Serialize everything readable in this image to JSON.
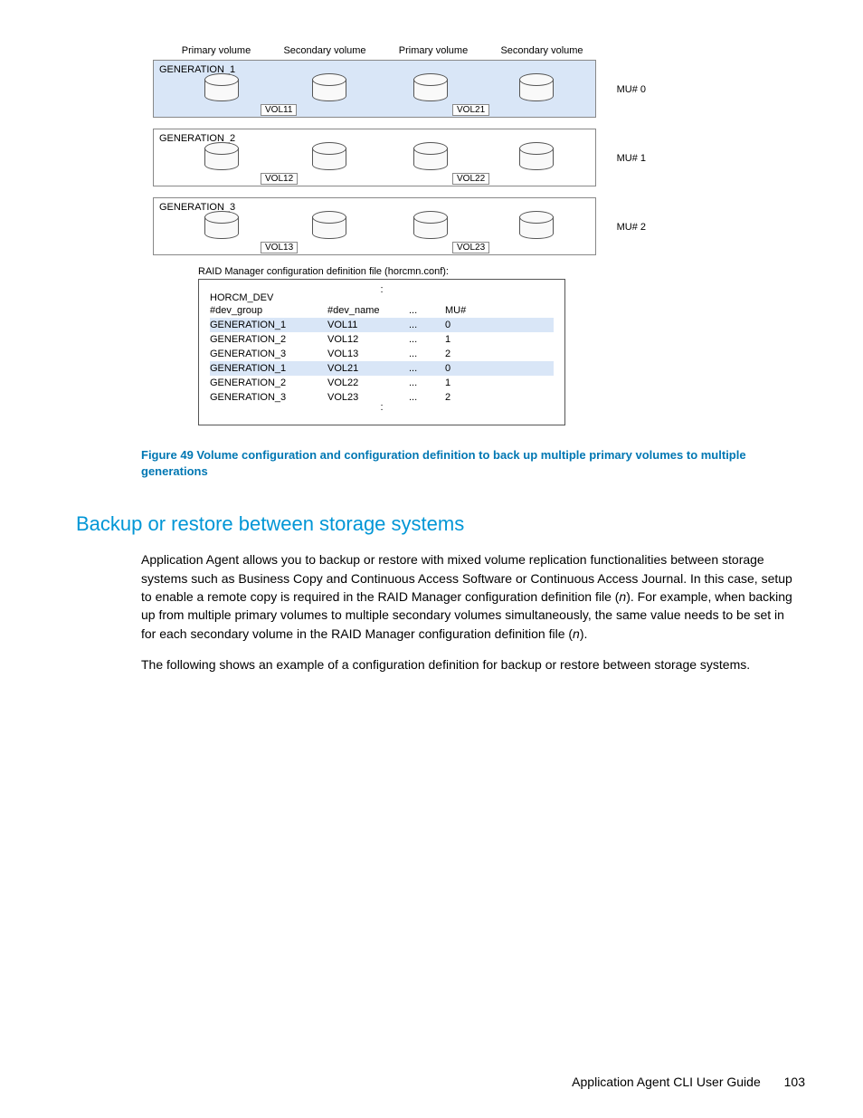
{
  "chart_data": {
    "type": "table",
    "diagram": {
      "column_headers": [
        "Primary volume",
        "Secondary volume",
        "Primary volume",
        "Secondary volume"
      ],
      "generations": [
        {
          "label": "GENERATION_1",
          "highlight": true,
          "vol_a": "VOL11",
          "vol_b": "VOL21",
          "mu": "MU# 0"
        },
        {
          "label": "GENERATION_2",
          "highlight": false,
          "vol_a": "VOL12",
          "vol_b": "VOL22",
          "mu": "MU# 1"
        },
        {
          "label": "GENERATION_3",
          "highlight": false,
          "vol_a": "VOL13",
          "vol_b": "VOL23",
          "mu": "MU# 2"
        }
      ]
    },
    "config_caption": "RAID Manager configuration definition file (horcmn.conf):",
    "config_header_title": "HORCM_DEV",
    "config_columns": {
      "c1": "#dev_group",
      "c2": "#dev_name",
      "c3": "...",
      "c4": "MU#"
    },
    "config_rows": [
      {
        "g": "GENERATION_1",
        "v": "VOL11",
        "d": "...",
        "m": "0",
        "hl": true
      },
      {
        "g": "GENERATION_2",
        "v": "VOL12",
        "d": "...",
        "m": "1",
        "hl": false
      },
      {
        "g": "GENERATION_3",
        "v": "VOL13",
        "d": "...",
        "m": "2",
        "hl": false
      },
      {
        "g": "GENERATION_1",
        "v": "VOL21",
        "d": "...",
        "m": "0",
        "hl": true
      },
      {
        "g": "GENERATION_2",
        "v": "VOL22",
        "d": "...",
        "m": "1",
        "hl": false
      },
      {
        "g": "GENERATION_3",
        "v": "VOL23",
        "d": "...",
        "m": "2",
        "hl": false
      }
    ]
  },
  "figure_caption": "Figure 49 Volume configuration and configuration definition to back up multiple primary volumes to multiple generations",
  "section_heading": "Backup or restore between storage systems",
  "para1_a": "Application Agent allows you to backup or restore with mixed volume replication functionalities between storage systems such as Business Copy and Continuous Access Software or Continuous Access Journal. In this case, setup to enable a remote copy is required in the RAID Manager configuration definition file (",
  "para1_n1": "n",
  "para1_b": "). For example, when backing up from multiple primary volumes to multiple secondary volumes simultaneously, the same value needs to be set in ",
  "para1_c": " for each secondary volume in the RAID Manager configuration definition file (",
  "para1_n2": "n",
  "para1_d": ").",
  "para2": "The following shows an example of a configuration definition for backup or restore between storage systems.",
  "footer_text": "Application Agent CLI User Guide",
  "page_number": "103"
}
